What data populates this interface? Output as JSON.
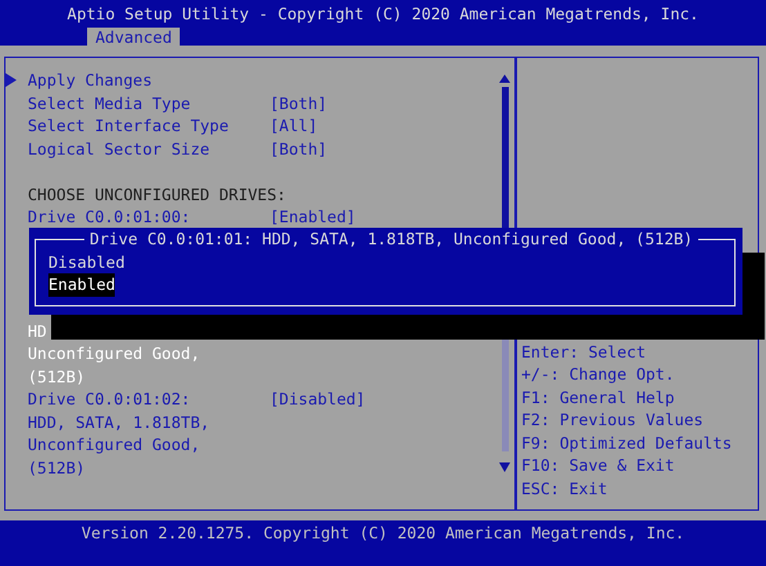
{
  "header": {
    "title": "Aptio Setup Utility - Copyright (C) 2020 American Megatrends, Inc.",
    "tabs": [
      {
        "label": "Advanced",
        "selected": true
      }
    ]
  },
  "menu": {
    "items": [
      {
        "kind": "submenu",
        "label": "Apply Changes",
        "value": null,
        "selected": false
      },
      {
        "kind": "setting",
        "label": "Select Media Type",
        "value": "[Both]",
        "selected": false
      },
      {
        "kind": "setting",
        "label": "Select Interface Type",
        "value": "[All]",
        "selected": false
      },
      {
        "kind": "setting",
        "label": "Logical Sector Size",
        "value": "[Both]",
        "selected": false
      },
      {
        "kind": "heading",
        "label": "CHOOSE UNCONFIGURED DRIVES:"
      },
      {
        "kind": "setting",
        "label": "Drive C0.0:01:00:",
        "value": "[Enabled]",
        "selected": false
      },
      {
        "kind": "detail",
        "lines": [
          "HD",
          "Unconfigured Good,",
          "(512B)"
        ],
        "selected": true
      },
      {
        "kind": "setting",
        "label": "Drive C0.0:01:02:",
        "value": "[Disabled]",
        "selected": false,
        "lines": [
          "HDD, SATA, 1.818TB,",
          "Unconfigured Good,",
          "(512B)"
        ]
      }
    ]
  },
  "help": [
    "Enter: Select",
    "+/-: Change Opt.",
    "F1: General Help",
    "F2: Previous Values",
    "F9: Optimized Defaults",
    "F10: Save & Exit",
    "ESC: Exit"
  ],
  "popup": {
    "title": "Drive C0.0:01:01: HDD, SATA, 1.818TB, Unconfigured Good, (512B)",
    "options": [
      {
        "label": "Disabled",
        "selected": false
      },
      {
        "label": "Enabled",
        "selected": true
      }
    ]
  },
  "footer": "Version 2.20.1275. Copyright (C) 2020 American Megatrends, Inc."
}
